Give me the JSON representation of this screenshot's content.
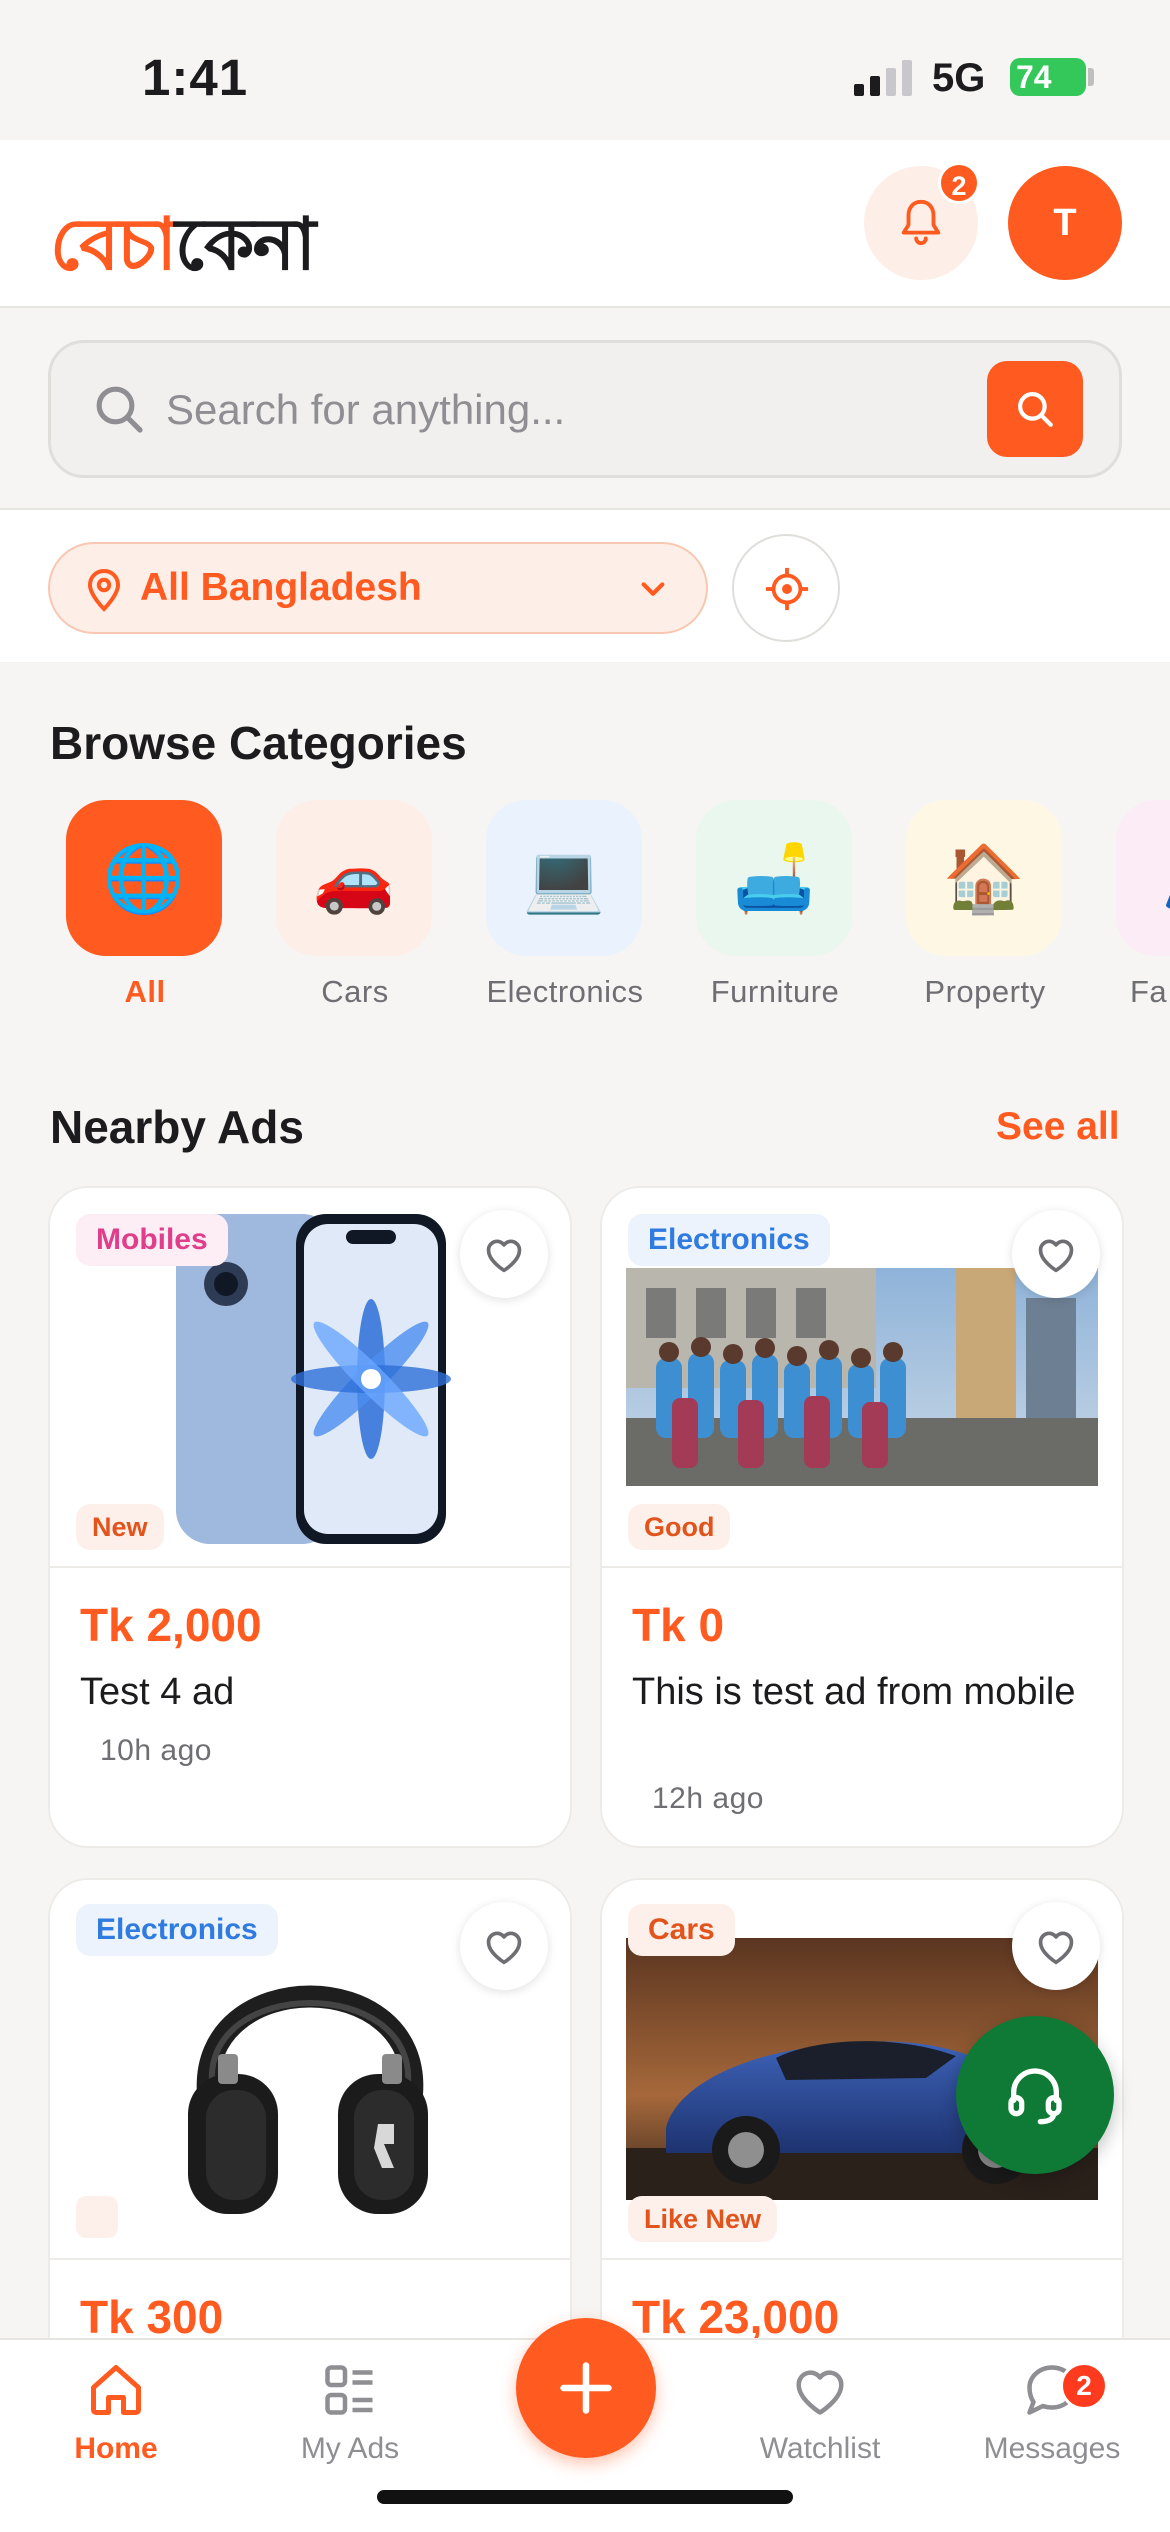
{
  "status_bar": {
    "time": "1:41",
    "network": "5G",
    "battery": "74"
  },
  "header": {
    "logo_part1": "বেচা",
    "logo_part2": "কেনা",
    "notifications_count": "2",
    "avatar_initial": "T"
  },
  "search": {
    "placeholder": "Search for anything..."
  },
  "location": {
    "label": "All Bangladesh"
  },
  "categories": {
    "title": "Browse Categories",
    "items": [
      {
        "label": "All",
        "emoji": "🌐"
      },
      {
        "label": "Cars",
        "emoji": "🚗"
      },
      {
        "label": "Electronics",
        "emoji": "💻"
      },
      {
        "label": "Furniture",
        "emoji": "🛋️"
      },
      {
        "label": "Property",
        "emoji": "🏠"
      },
      {
        "label": "Fa",
        "emoji": "👗"
      }
    ]
  },
  "nearby": {
    "title": "Nearby Ads",
    "see_all": "See all",
    "ads": [
      {
        "category": "Mobiles",
        "condition": "New",
        "price": "Tk 2,000",
        "title": "Test 4 ad",
        "time": "10h ago"
      },
      {
        "category": "Electronics",
        "condition": "Good",
        "price": "Tk 0",
        "title": "This is test ad from mobile",
        "time": "12h ago"
      },
      {
        "category": "Electronics",
        "condition": "",
        "price": "Tk 300",
        "title": "",
        "time": ""
      },
      {
        "category": "Cars",
        "condition": "Like New",
        "price": "Tk 23,000",
        "title": "",
        "time": ""
      }
    ]
  },
  "bottom_nav": {
    "home": "Home",
    "my_ads": "My Ads",
    "watchlist": "Watchlist",
    "messages": "Messages",
    "messages_count": "2"
  },
  "colors": {
    "brand": "#ff5a1f",
    "support": "#0f7a35"
  }
}
